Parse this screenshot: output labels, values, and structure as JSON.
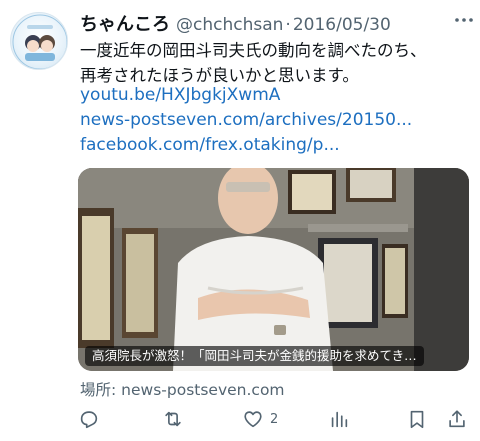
{
  "tweet": {
    "display_name": "ちゃんころ",
    "handle": "@chchchsan",
    "separator": "·",
    "date": "2016/05/30",
    "more_icon": "more-horizontal-icon",
    "body_line1": "一度近年の岡田斗司夫氏の動向を調べたのち、",
    "body_line2": "再考されたほうが良いかと思います。",
    "links": [
      "youtu.be/HXJbgkjXwmA",
      "news-postseven.com/archives/20150...",
      "facebook.com/frex.otaking/p..."
    ]
  },
  "card": {
    "caption": "高須院長が激怒！「岡田斗司夫が金銭的援助を求めてき…",
    "domain_label": "場所:",
    "domain": "news-postseven.com"
  },
  "actions": {
    "reply_icon": "reply-icon",
    "retweet_icon": "retweet-icon",
    "like_icon": "heart-icon",
    "like_count": "2",
    "views_icon": "views-icon",
    "bookmark_icon": "bookmark-icon",
    "share_icon": "share-icon"
  },
  "colors": {
    "text": "#0f1419",
    "secondary": "#536471",
    "link": "#1d6fc0"
  }
}
